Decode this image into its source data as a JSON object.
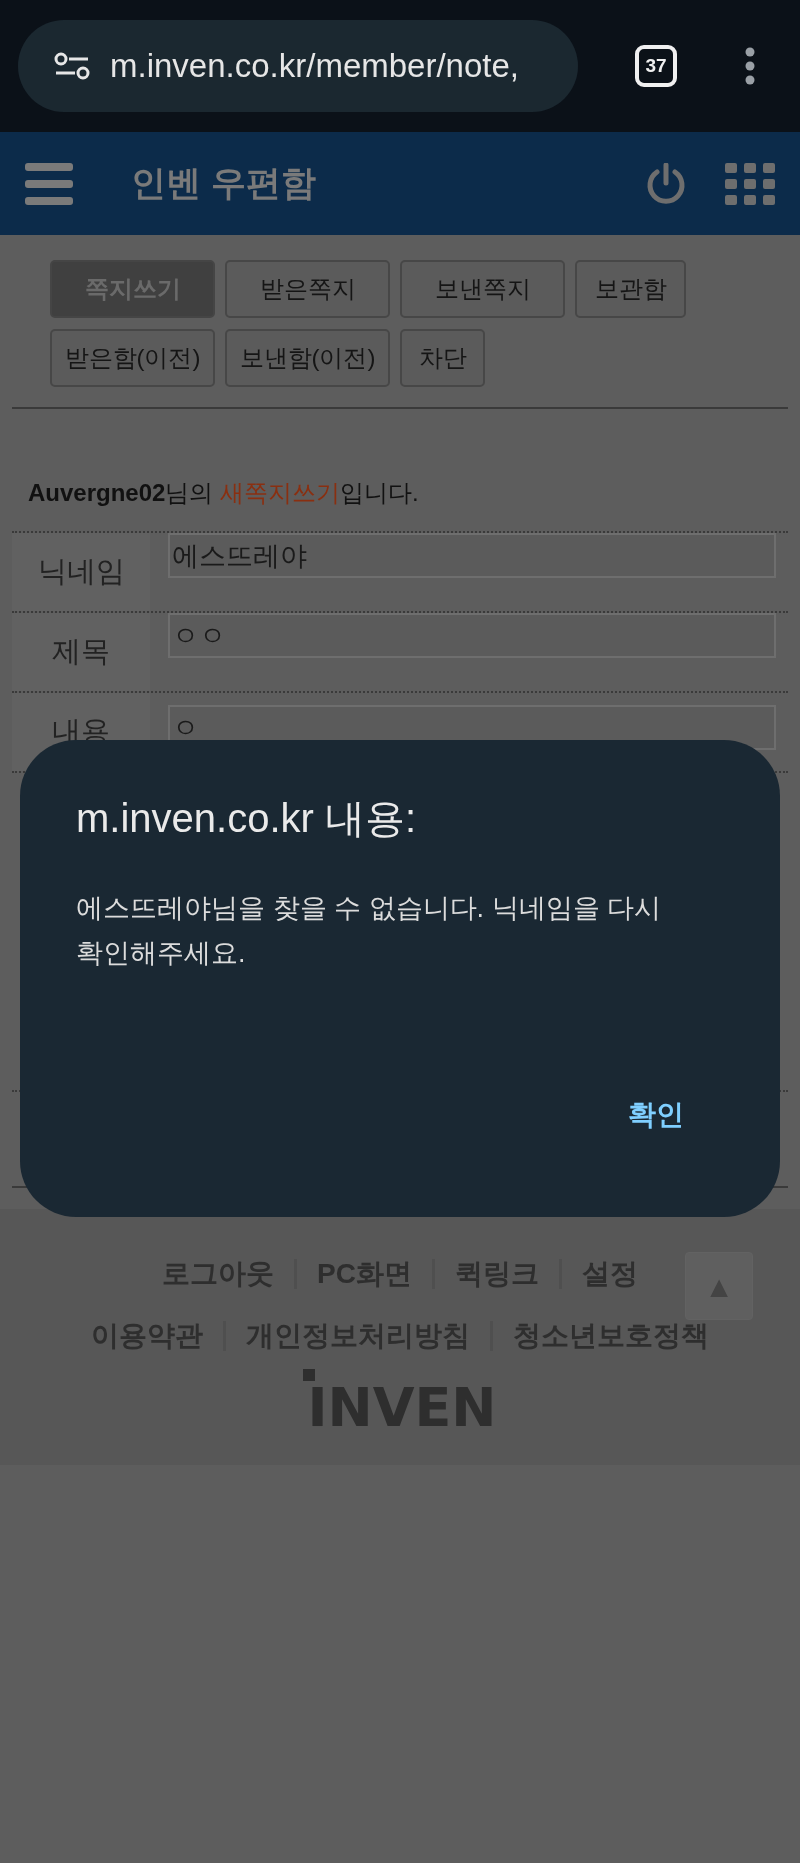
{
  "browser": {
    "url": "m.inven.co.kr/member/note,",
    "tab_count": "37"
  },
  "header": {
    "title": "인벤 우편함"
  },
  "tabs": [
    {
      "label": "쪽지쓰기",
      "selected": true
    },
    {
      "label": "받은쪽지",
      "selected": false
    },
    {
      "label": "보낸쪽지",
      "selected": false
    },
    {
      "label": "보관함",
      "selected": false
    },
    {
      "label": "받은함(이전)",
      "selected": false
    },
    {
      "label": "보낸함(이전)",
      "selected": false
    },
    {
      "label": "차단",
      "selected": false
    }
  ],
  "greeting": [
    {
      "kind": "name",
      "text": "Auvergne02"
    },
    {
      "kind": "plain",
      "text": "님의 "
    },
    {
      "kind": "highlight",
      "text": "새쪽지쓰기"
    },
    {
      "kind": "plain",
      "text": "입니다."
    }
  ],
  "form": [
    {
      "label": "닉네임",
      "value": "에스뜨레야"
    },
    {
      "label": "제목",
      "value": "ㅇㅇ"
    },
    {
      "label": "내용",
      "value": "ㅇ"
    }
  ],
  "dialog": {
    "title": "m.inven.co.kr 내용:",
    "message": "에스뜨레야님을 찾을 수 없습니다. 닉네임을 다시 확인해주세요.",
    "button": "확인"
  },
  "footer": {
    "links": [
      [
        "로그아웃",
        "PC화면",
        "퀵링크",
        "설정"
      ],
      [
        "이용약관",
        "개인정보처리방침",
        "청소년보호정책"
      ]
    ],
    "scroll_top": "▲",
    "logo": "INVEN"
  }
}
